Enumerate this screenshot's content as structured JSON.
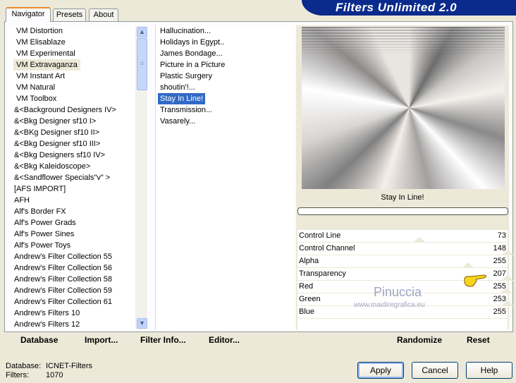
{
  "title": "Filters Unlimited 2.0",
  "tabs": [
    "Navigator",
    "Presets",
    "About"
  ],
  "categories": [
    "VM Distortion",
    "VM Elisablaze",
    "VM Experimental",
    "VM Extravaganza",
    "VM Instant Art",
    "VM Natural",
    "VM Toolbox",
    "&<Background Designers IV>",
    "&<Bkg Designer sf10 I>",
    "&<BKg Designer sf10 II>",
    "&<Bkg Designer sf10 III>",
    "&<Bkg Designers sf10 IV>",
    "&<Bkg Kaleidoscope>",
    "&<Sandflower Specials\"v\" >",
    "[AFS IMPORT]",
    "AFH",
    "Alf's Border FX",
    "Alf's Power Grads",
    "Alf's Power Sines",
    "Alf's Power Toys",
    "Andrew's Filter Collection 55",
    "Andrew's Filter Collection 56",
    "Andrew's Filter Collection 58",
    "Andrew's Filter Collection 59",
    "Andrew's Filter Collection 61",
    "Andrew's Filters 10",
    "Andrew's Filters 12"
  ],
  "selected_category_index": 3,
  "filters": [
    "Hallucination...",
    "Holidays in Egypt..",
    "James Bondage...",
    "Picture in a Picture",
    "Plastic Surgery",
    "shoutin'!...",
    "Stay In Line!",
    "Transmission...",
    "Vasarely..."
  ],
  "selected_filter_index": 6,
  "filter_name": "Stay In Line!",
  "progress": 0,
  "params": [
    {
      "label": "Control Line",
      "value": 73
    },
    {
      "label": "Control Channel",
      "value": 148
    },
    {
      "label": "Alpha",
      "value": 255
    },
    {
      "label": "Transparency",
      "value": 207
    },
    {
      "label": "Red",
      "value": 255
    },
    {
      "label": "Green",
      "value": 253
    },
    {
      "label": "Blue",
      "value": 255
    }
  ],
  "bottom_buttons": {
    "database": "Database",
    "import": "Import...",
    "filter_info": "Filter Info...",
    "editor": "Editor...",
    "randomize": "Randomize",
    "reset": "Reset"
  },
  "status": {
    "database_label": "Database:",
    "database_value": "ICNET-Filters",
    "filters_label": "Filters:",
    "filters_value": "1070"
  },
  "dialog_buttons": {
    "apply": "Apply",
    "cancel": "Cancel",
    "help": "Help"
  },
  "watermark": {
    "name": "Pinuccia",
    "url": "www.maidiregrafica.eu"
  }
}
